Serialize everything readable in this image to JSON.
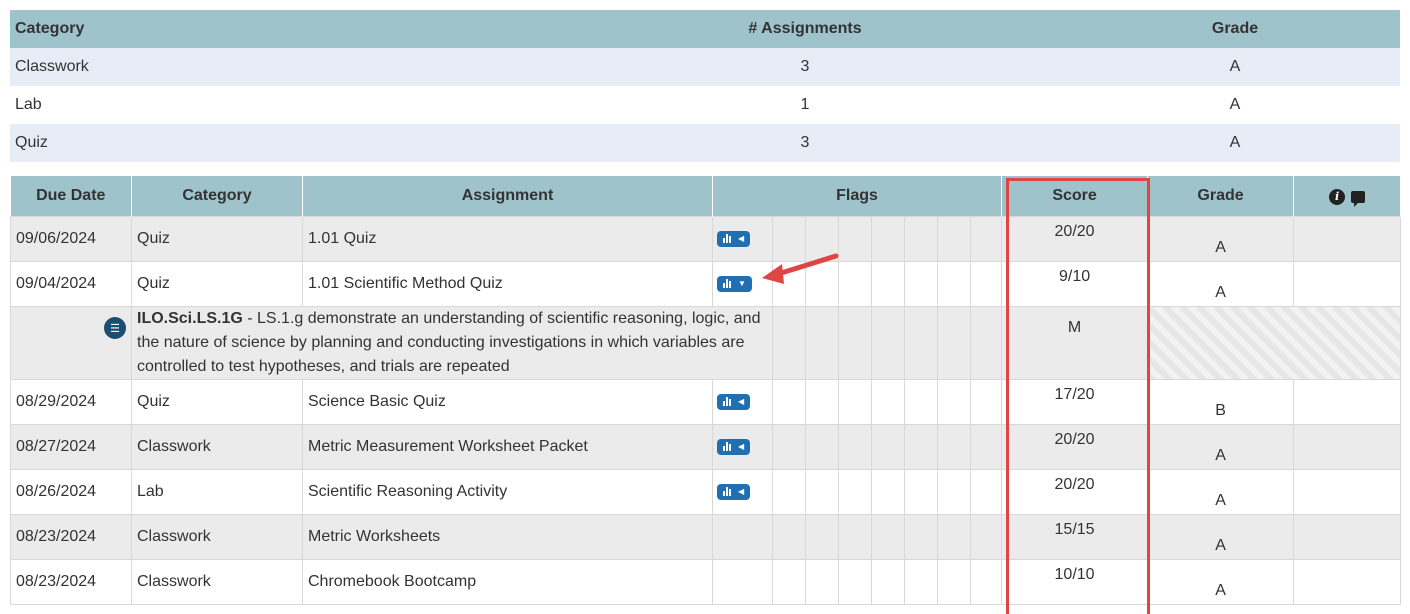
{
  "summary": {
    "headers": [
      "Category",
      "# Assignments",
      "Grade"
    ],
    "rows": [
      {
        "category": "Classwork",
        "count": "3",
        "grade": "A"
      },
      {
        "category": "Lab",
        "count": "1",
        "grade": "A"
      },
      {
        "category": "Quiz",
        "count": "3",
        "grade": "A"
      }
    ]
  },
  "assignments": {
    "headers": {
      "due_date": "Due Date",
      "category": "Category",
      "assignment": "Assignment",
      "flags": "Flags",
      "score": "Score",
      "grade": "Grade"
    },
    "header_icons": [
      "info-icon",
      "comment-icon"
    ],
    "rows": [
      {
        "due": "09/06/2024",
        "category": "Quiz",
        "name": "1.01 Quiz",
        "score": "20/20",
        "grade": "A",
        "flag_icon": "chevron-left-icon"
      },
      {
        "due": "09/04/2024",
        "category": "Quiz",
        "name": "1.01 Scientific Method Quiz",
        "score": "9/10",
        "grade": "A",
        "flag_icon": "chevron-down-icon"
      },
      {
        "due": "08/29/2024",
        "category": "Quiz",
        "name": "Science Basic Quiz",
        "score": "17/20",
        "grade": "B",
        "flag_icon": "chevron-left-icon"
      },
      {
        "due": "08/27/2024",
        "category": "Classwork",
        "name": "Metric Measurement Worksheet Packet",
        "score": "20/20",
        "grade": "A",
        "flag_icon": "chevron-left-icon"
      },
      {
        "due": "08/26/2024",
        "category": "Lab",
        "name": "Scientific Reasoning Activity",
        "score": "20/20",
        "grade": "A",
        "flag_icon": "chevron-left-icon"
      },
      {
        "due": "08/23/2024",
        "category": "Classwork",
        "name": "Metric Worksheets",
        "score": "15/15",
        "grade": "A"
      },
      {
        "due": "08/23/2024",
        "category": "Classwork",
        "name": "Chromebook Bootcamp",
        "score": "10/10",
        "grade": "A"
      }
    ],
    "standard": {
      "code": "ILO.Sci.LS.1G",
      "description": " - LS.1.g demonstrate an understanding of scientific reasoning, logic, and the nature of science by planning and conducting investigations in which variables are controlled to test hypotheses, and trials are repeated",
      "score": "M"
    }
  },
  "colors": {
    "header_bg": "#9fc3cb",
    "flag_button": "#1f6fb2",
    "highlight": "#e04545",
    "row_shade": "#ebebeb",
    "summary_shade": "#e7edf7"
  }
}
